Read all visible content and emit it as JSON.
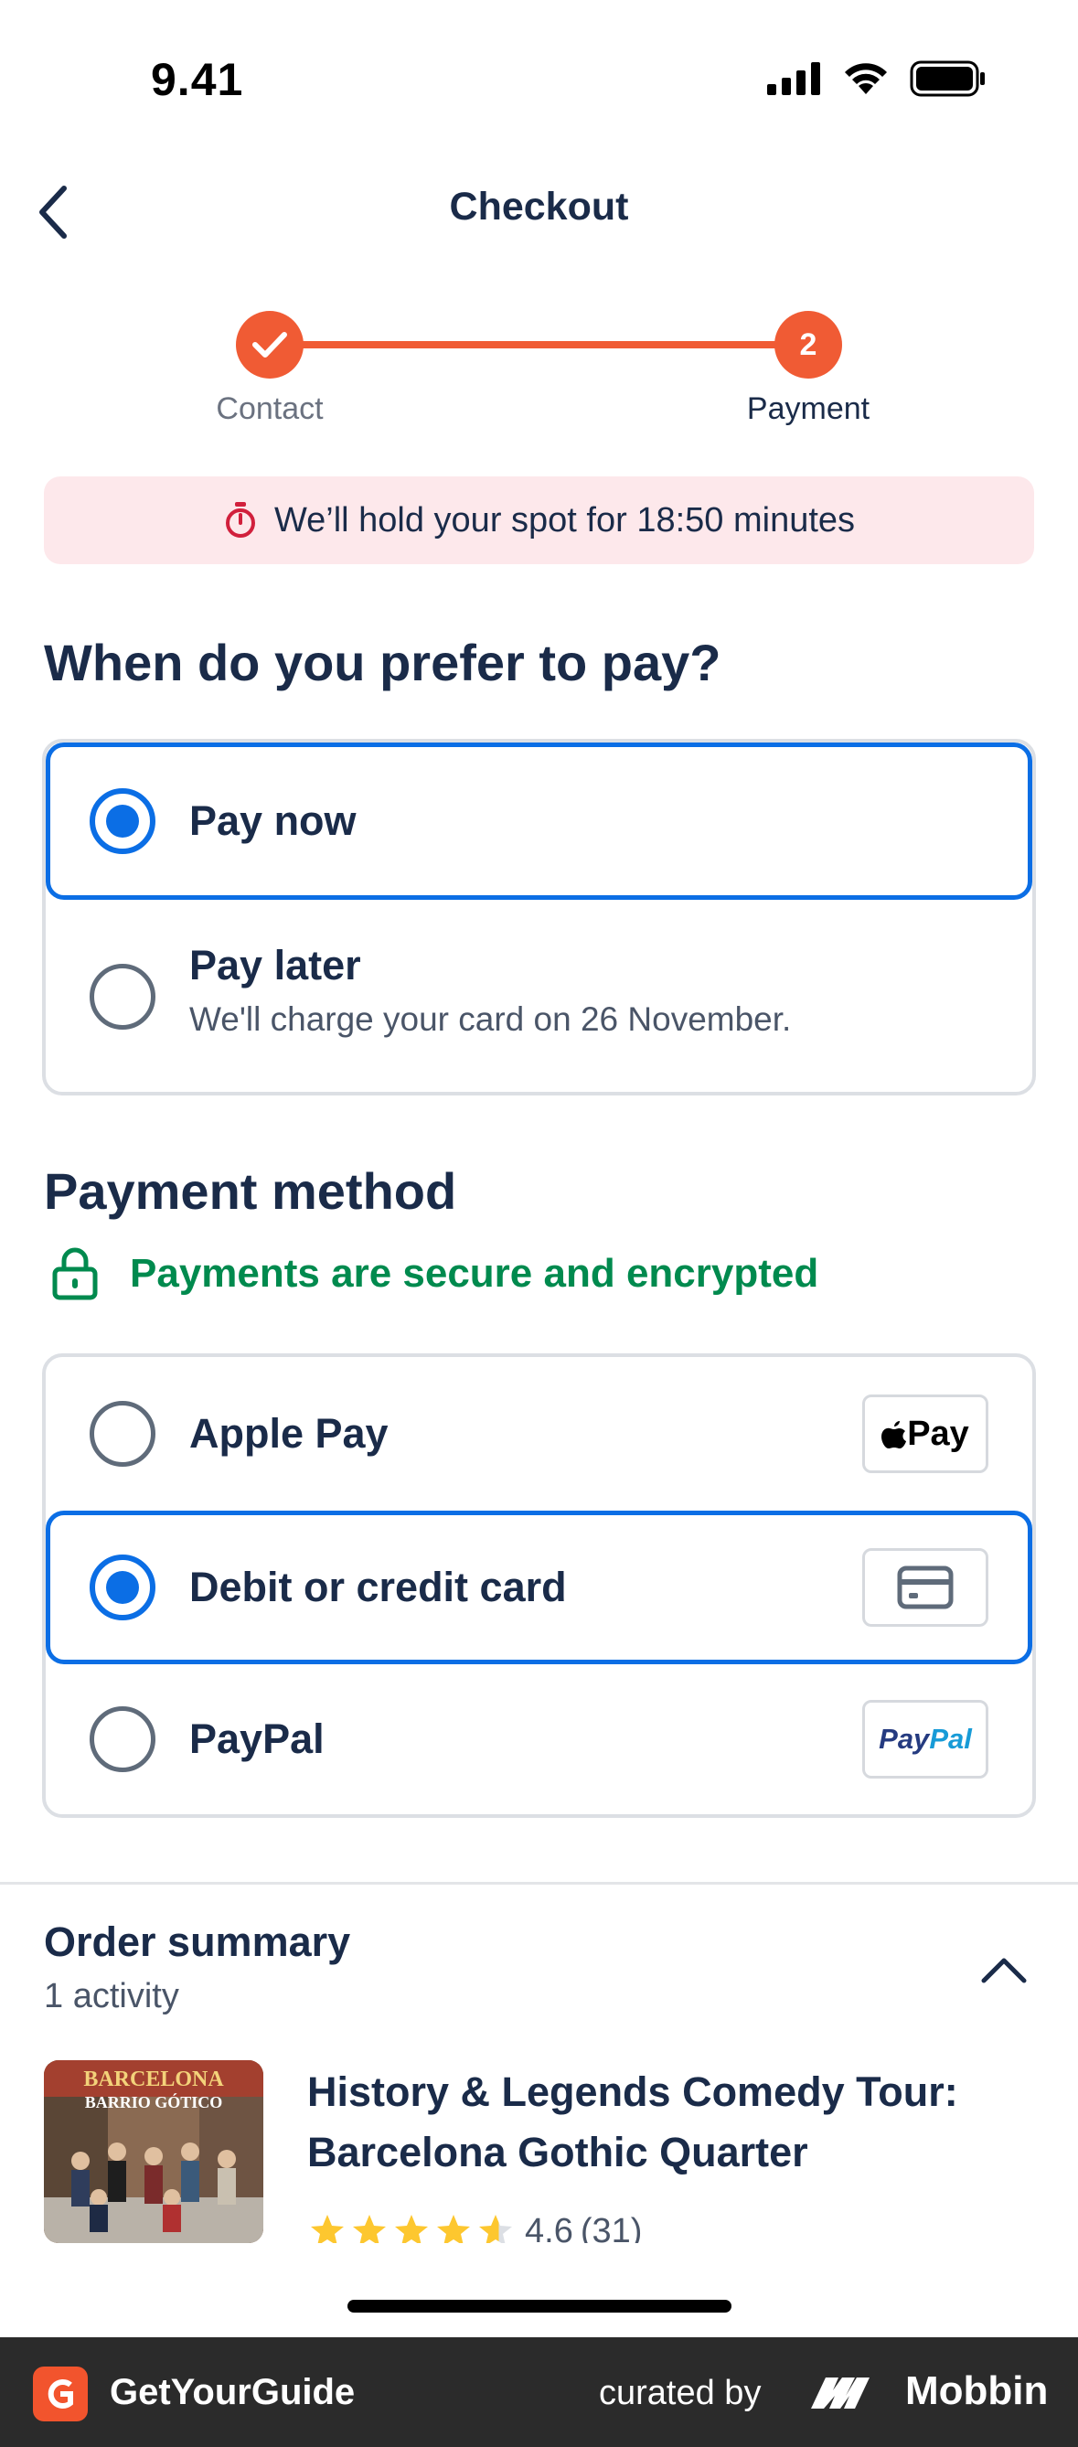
{
  "status_bar": {
    "time": "9.41"
  },
  "nav": {
    "title": "Checkout"
  },
  "stepper": {
    "steps": [
      {
        "label": "Contact",
        "state": "done"
      },
      {
        "label": "Payment",
        "number": "2",
        "state": "current"
      }
    ]
  },
  "hold_banner": {
    "text": "We’ll hold your spot for 18:50 minutes"
  },
  "pay_timing": {
    "title": "When do you prefer to pay?",
    "options": [
      {
        "label": "Pay now",
        "selected": true
      },
      {
        "label": "Pay later",
        "sublabel": "We'll charge your card on 26 November.",
        "selected": false
      }
    ]
  },
  "payment_method": {
    "title": "Payment method",
    "secure_text": "Payments are secure and encrypted",
    "options": [
      {
        "label": "Apple Pay",
        "logo": "apple-pay-logo",
        "logo_text": "Pay",
        "selected": false
      },
      {
        "label": "Debit or credit card",
        "logo": "credit-card-icon",
        "selected": true
      },
      {
        "label": "PayPal",
        "logo": "paypal-logo",
        "logo_text": "PayPal",
        "selected": false
      }
    ]
  },
  "order_summary": {
    "title": "Order summary",
    "count": "1 activity",
    "activity": {
      "title": "History & Legends Comedy Tour: Barcelona Gothic Quarter",
      "rating": "4.6",
      "reviews": "(31)",
      "stars": 4.6,
      "thumb_text_top": "BARCELONA",
      "thumb_text_bottom": "BARRIO GÓTICO"
    }
  },
  "footer": {
    "brand": "GetYourGuide",
    "curated_by": "curated by",
    "mobbin": "Mobbin"
  },
  "colors": {
    "accent_orange": "#f05b34",
    "selected_blue": "#0b6ee5",
    "secure_green": "#008a4e",
    "banner_pink": "#fde8eb",
    "text_dark": "#1a2b49"
  }
}
